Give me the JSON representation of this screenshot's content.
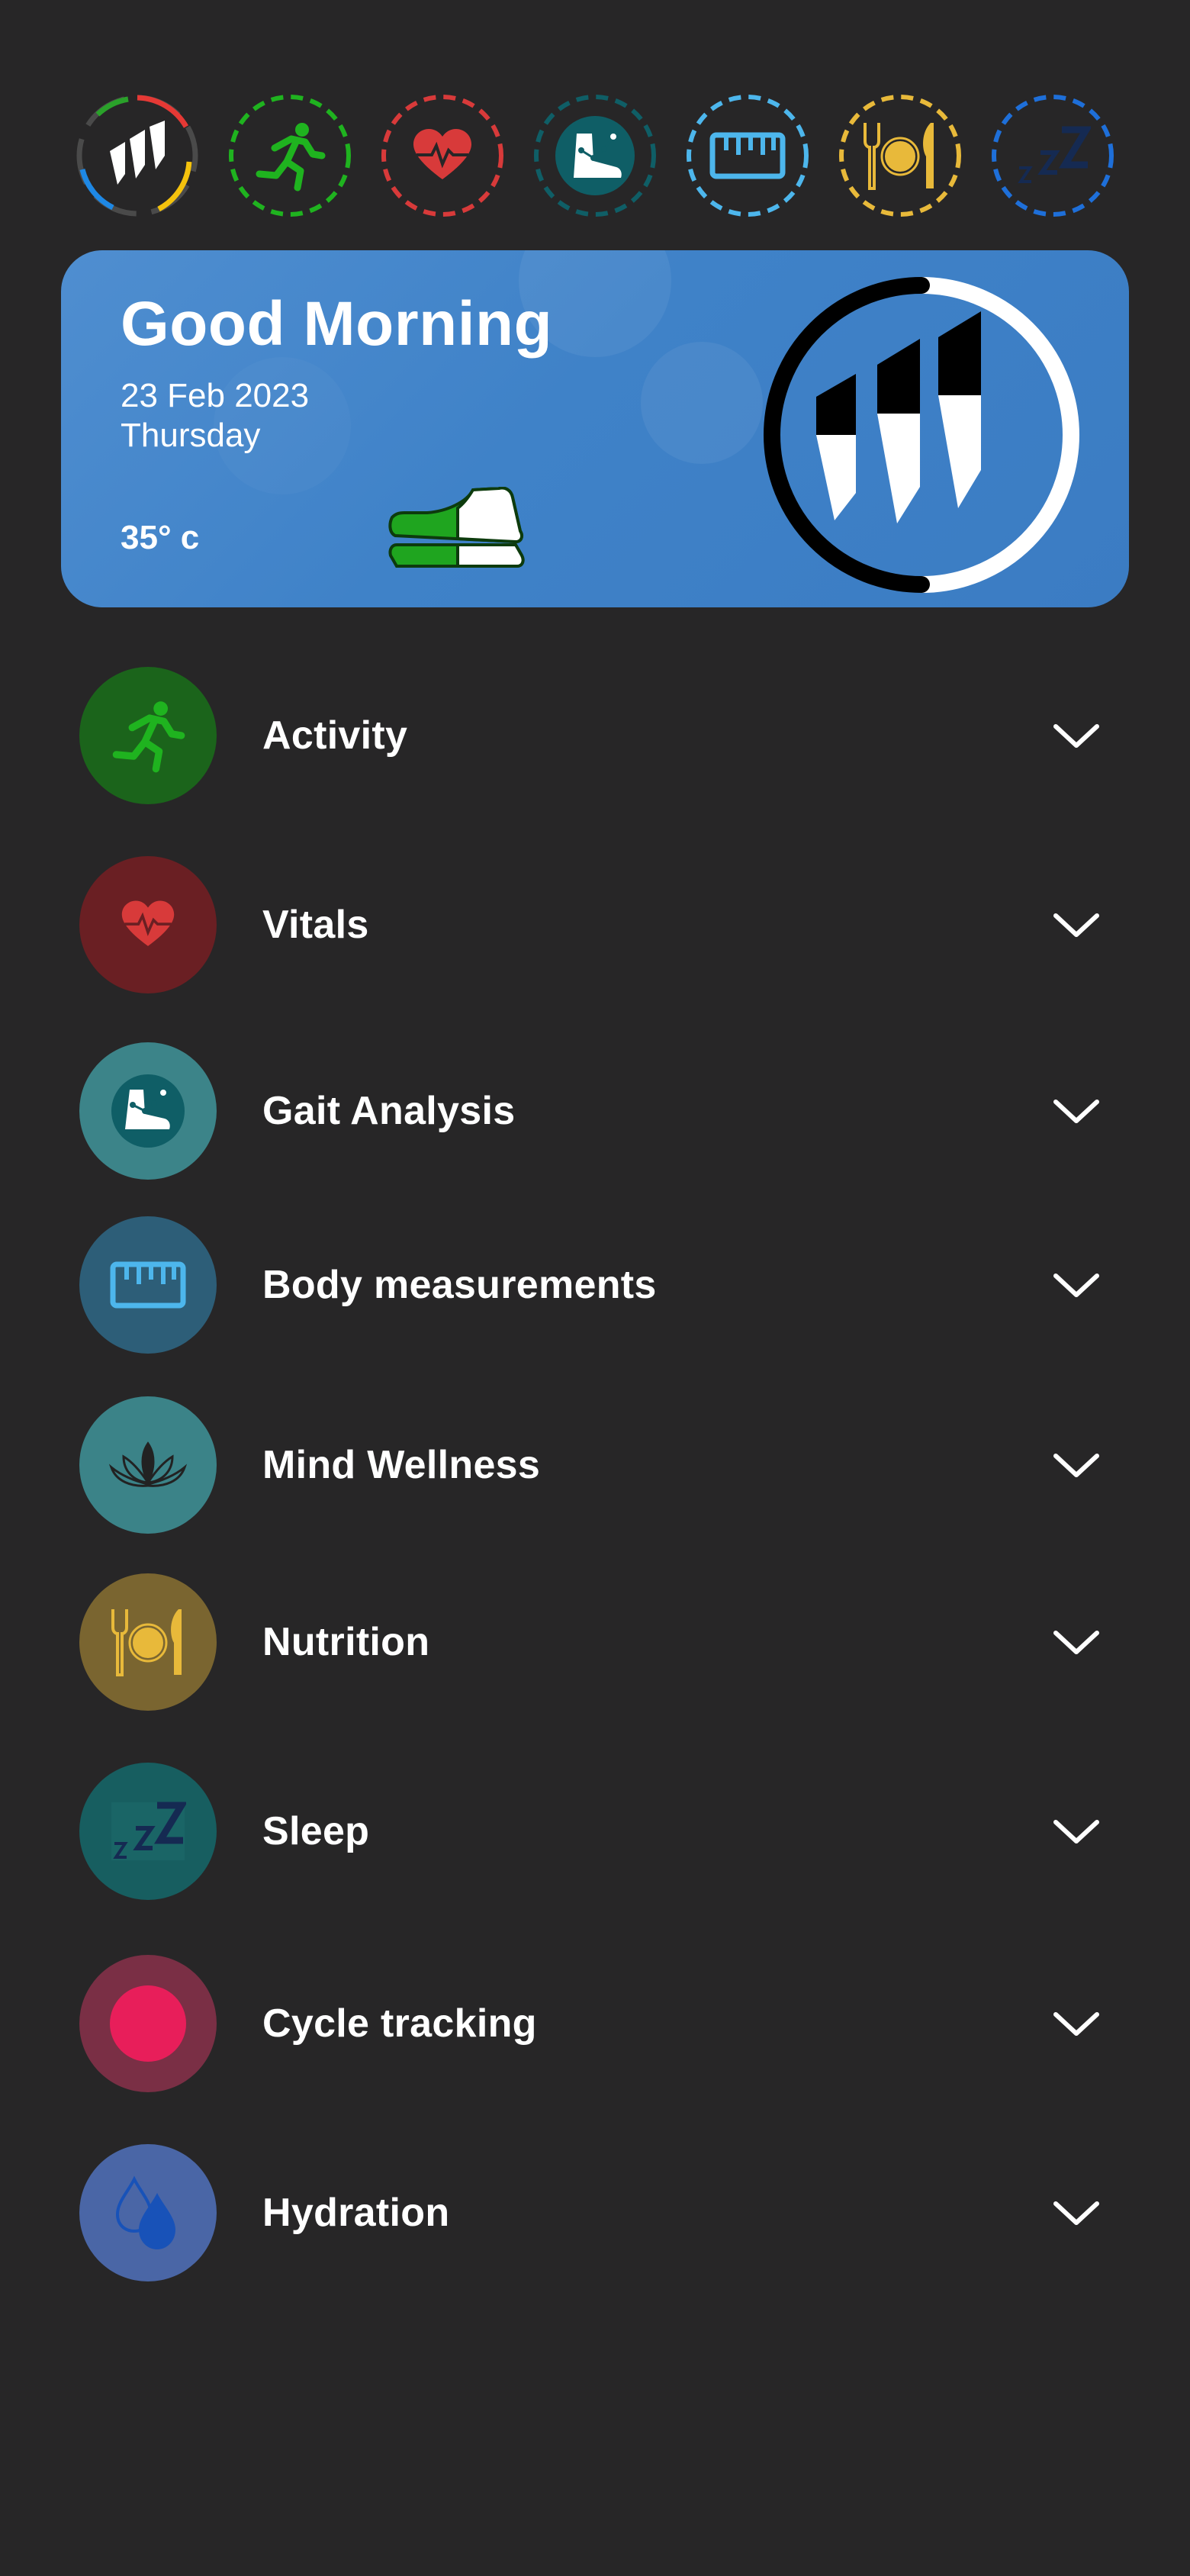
{
  "header_rings": [
    {
      "name": "brand",
      "color": "#c9c9c9"
    },
    {
      "name": "activity",
      "color": "#1fb31f"
    },
    {
      "name": "vitals",
      "color": "#d83a3a"
    },
    {
      "name": "gait",
      "color": "#0f5e66"
    },
    {
      "name": "body",
      "color": "#4db6ec"
    },
    {
      "name": "nutrition",
      "color": "#e8b93a"
    },
    {
      "name": "sleep",
      "color": "#1e6fd9"
    }
  ],
  "card": {
    "greeting": "Good Morning",
    "date": "23 Feb 2023",
    "day": "Thursday",
    "temperature": "35° c"
  },
  "list": [
    {
      "key": "activity",
      "label": "Activity",
      "icon": "running-icon",
      "bg": "#1b641b"
    },
    {
      "key": "vitals",
      "label": "Vitals",
      "icon": "heart-pulse-icon",
      "bg": "#6a1f23"
    },
    {
      "key": "gait",
      "label": "Gait Analysis",
      "icon": "foot-analysis-icon",
      "bg": "#3c8489"
    },
    {
      "key": "body",
      "label": "Body measurements",
      "icon": "ruler-icon",
      "bg": "#2d5e78"
    },
    {
      "key": "mind",
      "label": "Mind Wellness",
      "icon": "lotus-icon",
      "bg": "#3b8388"
    },
    {
      "key": "nutrition",
      "label": "Nutrition",
      "icon": "plate-cutlery-icon",
      "bg": "#7a6530"
    },
    {
      "key": "sleep",
      "label": "Sleep",
      "icon": "sleep-zzz-icon",
      "bg": "#175e60"
    },
    {
      "key": "cycle",
      "label": "Cycle tracking",
      "icon": "cycle-dot-icon",
      "bg": "#7a2f45"
    },
    {
      "key": "hydration",
      "label": "Hydration",
      "icon": "water-drops-icon",
      "bg": "#4a66a6"
    }
  ]
}
